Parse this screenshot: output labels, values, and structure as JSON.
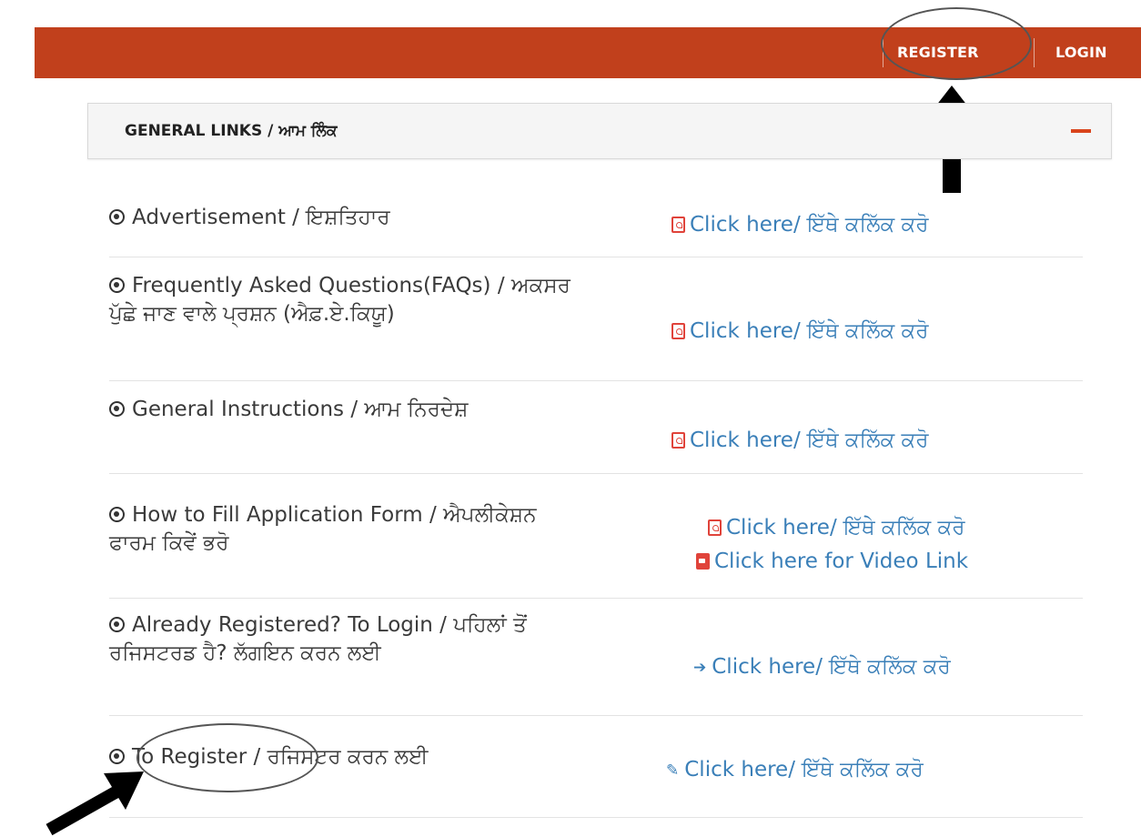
{
  "nav": {
    "register_label": "REGISTER",
    "login_label": "LOGIN"
  },
  "panel": {
    "title": "GENERAL LINKS / ਆਮ ਲਿੰਕ"
  },
  "rows": [
    {
      "label": "Advertisement / ਇਸ਼ਤਿਹਾਰ",
      "link": "Click here/ ਇੱਥੇ ਕਲਿੱਕ ਕਰੋ",
      "icon": "pdf-icon"
    },
    {
      "label": "Frequently Asked Questions(FAQs) / ਅਕਸਰ ਪੁੱਛੇ ਜਾਣ ਵਾਲੇ ਪ੍ਰਸ਼ਨ (ਐਫ਼.ਏ.ਕਿਯੂ)",
      "link": "Click here/ ਇੱਥੇ ਕਲਿੱਕ ਕਰੋ",
      "icon": "pdf-icon"
    },
    {
      "label": "General Instructions / ਆਮ ਨਿਰਦੇਸ਼",
      "link": "Click here/ ਇੱਥੇ ਕਲਿੱਕ ਕਰੋ",
      "icon": "pdf-icon"
    },
    {
      "label": "How to Fill Application Form / ਐਪਲੀਕੇਸ਼ਨ ਫਾਰਮ ਕਿਵੇਂ ਭਰੋ",
      "link": "Click here/ ਇੱਥੇ ਕਲਿੱਕ ਕਰੋ",
      "link2": "Click here for Video Link",
      "icon": "pdf-icon",
      "icon2": "video-icon"
    },
    {
      "label": "Already Registered? To Login / ਪਹਿਲਾਂ ਤੋਂ ਰਜਿਸਟਰਡ ਹੈ? ਲੱਗਇਨ ਕਰਨ ਲਈ",
      "link": "Click here/ ਇੱਥੇ ਕਲਿੱਕ ਕਰੋ",
      "icon": "sign-in-icon"
    },
    {
      "label": "To Register / ਰਜਿਸਟਰ ਕਰਨ ਲਈ",
      "link": "Click here/ ਇੱਥੇ ਕਲਿੱਕ ਕਰੋ",
      "icon": "edit-icon"
    }
  ],
  "colors": {
    "topbar": "#c1401c",
    "link": "#3a7fb8",
    "pdf": "#e0433a",
    "collapse": "#d9441c"
  }
}
